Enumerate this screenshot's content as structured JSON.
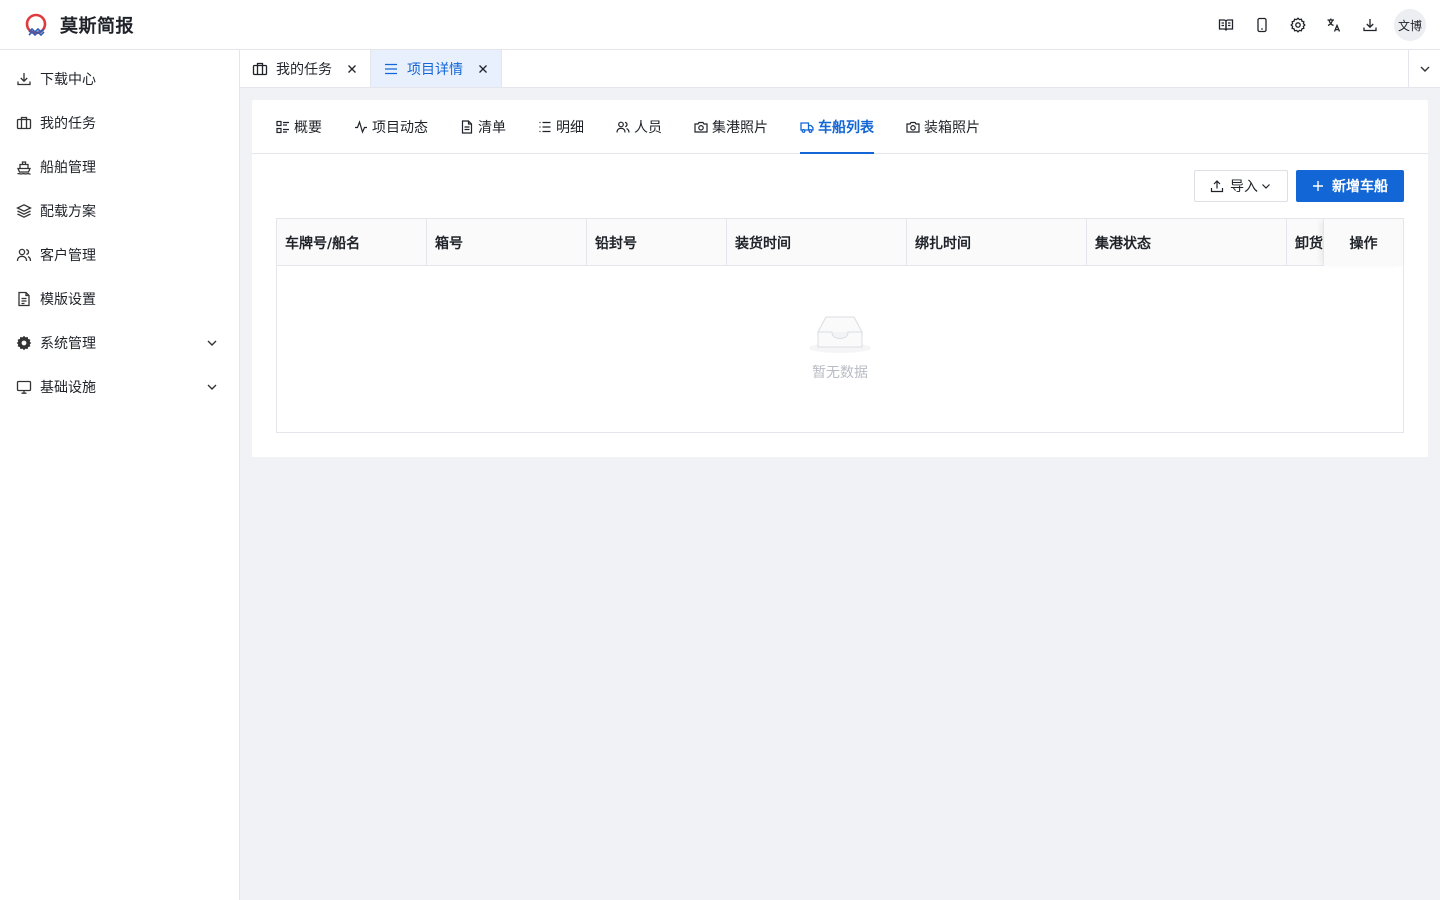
{
  "app": {
    "title": "莫斯简报"
  },
  "header": {
    "icons": [
      "book-open-icon",
      "mobile-icon",
      "settings-icon",
      "translate-icon",
      "download-icon"
    ],
    "avatar": "文博"
  },
  "sidebar": {
    "items": [
      {
        "label": "下载中心",
        "icon": "download-icon"
      },
      {
        "label": "我的任务",
        "icon": "briefcase-icon"
      },
      {
        "label": "船舶管理",
        "icon": "ship-icon"
      },
      {
        "label": "配载方案",
        "icon": "layers-icon"
      },
      {
        "label": "客户管理",
        "icon": "users-icon"
      },
      {
        "label": "模版设置",
        "icon": "document-icon"
      },
      {
        "label": "系统管理",
        "icon": "gear-icon",
        "expandable": true
      },
      {
        "label": "基础设施",
        "icon": "monitor-icon",
        "expandable": true
      }
    ]
  },
  "page_tabs": [
    {
      "label": "我的任务",
      "icon": "briefcase-icon",
      "active": false
    },
    {
      "label": "项目详情",
      "icon": "list-icon",
      "active": true
    }
  ],
  "sub_tabs": [
    {
      "label": "概要",
      "icon": "grid-list-icon"
    },
    {
      "label": "项目动态",
      "icon": "activity-icon"
    },
    {
      "label": "清单",
      "icon": "file-icon"
    },
    {
      "label": "明细",
      "icon": "list-icon"
    },
    {
      "label": "人员",
      "icon": "users-icon"
    },
    {
      "label": "集港照片",
      "icon": "camera-icon"
    },
    {
      "label": "车船列表",
      "icon": "truck-icon",
      "active": true
    },
    {
      "label": "装箱照片",
      "icon": "camera-icon"
    }
  ],
  "toolbar": {
    "import_label": "导入",
    "add_label": "新增车船"
  },
  "table": {
    "columns": [
      "车牌号/船名",
      "箱号",
      "铅封号",
      "装货时间",
      "绑扎时间",
      "集港状态",
      "卸货",
      "操作"
    ],
    "rows": [],
    "empty_text": "暂无数据"
  },
  "colors": {
    "primary": "#1366d6",
    "active_tab_bg": "#e8f0fd",
    "logo_red": "#e0393e",
    "logo_blue": "#2d5fb8"
  }
}
